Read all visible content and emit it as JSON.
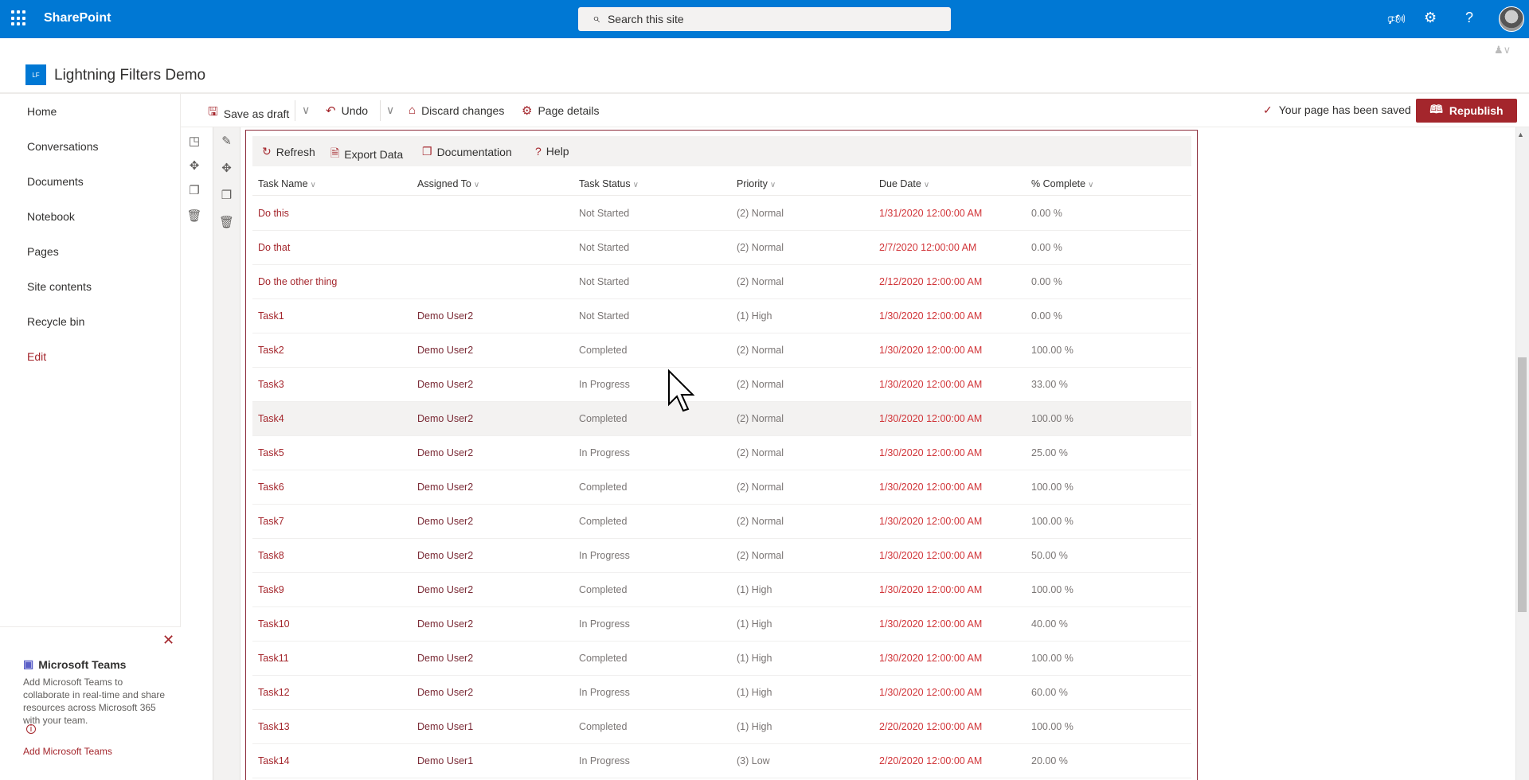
{
  "topbar": {
    "brand": "SharePoint",
    "search_placeholder": "Search this site",
    "icons": [
      "waffle-icon",
      "megaphone-icon",
      "gear-icon",
      "help-icon",
      "avatar"
    ]
  },
  "site": {
    "logo_text": "LF",
    "title": "Lightning Filters Demo"
  },
  "nav": {
    "items": [
      {
        "label": "Home"
      },
      {
        "label": "Conversations"
      },
      {
        "label": "Documents"
      },
      {
        "label": "Notebook"
      },
      {
        "label": "Pages"
      },
      {
        "label": "Site contents"
      },
      {
        "label": "Recycle bin"
      },
      {
        "label": "Edit"
      }
    ]
  },
  "commandbar": {
    "save_draft": "Save as draft",
    "undo": "Undo",
    "discard": "Discard changes",
    "page_details": "Page details",
    "saved_status": "Your page has been saved",
    "republish": "Republish"
  },
  "webpart": {
    "toolbar": {
      "refresh": "Refresh",
      "export": "Export Data",
      "documentation": "Documentation",
      "help": "Help"
    },
    "columns": [
      "Task Name",
      "Assigned To",
      "Task Status",
      "Priority",
      "Due Date",
      "% Complete"
    ],
    "rows": [
      [
        "Do this",
        "",
        "Not Started",
        "(2) Normal",
        "1/31/2020 12:00:00 AM",
        "0.00 %"
      ],
      [
        "Do that",
        "",
        "Not Started",
        "(2) Normal",
        "2/7/2020 12:00:00 AM",
        "0.00 %"
      ],
      [
        "Do the other thing",
        "",
        "Not Started",
        "(2) Normal",
        "2/12/2020 12:00:00 AM",
        "0.00 %"
      ],
      [
        "Task1",
        "Demo User2",
        "Not Started",
        "(1) High",
        "1/30/2020 12:00:00 AM",
        "0.00 %"
      ],
      [
        "Task2",
        "Demo User2",
        "Completed",
        "(2) Normal",
        "1/30/2020 12:00:00 AM",
        "100.00 %"
      ],
      [
        "Task3",
        "Demo User2",
        "In Progress",
        "(2) Normal",
        "1/30/2020 12:00:00 AM",
        "33.00 %"
      ],
      [
        "Task4",
        "Demo User2",
        "Completed",
        "(2) Normal",
        "1/30/2020 12:00:00 AM",
        "100.00 %"
      ],
      [
        "Task5",
        "Demo User2",
        "In Progress",
        "(2) Normal",
        "1/30/2020 12:00:00 AM",
        "25.00 %"
      ],
      [
        "Task6",
        "Demo User2",
        "Completed",
        "(2) Normal",
        "1/30/2020 12:00:00 AM",
        "100.00 %"
      ],
      [
        "Task7",
        "Demo User2",
        "Completed",
        "(2) Normal",
        "1/30/2020 12:00:00 AM",
        "100.00 %"
      ],
      [
        "Task8",
        "Demo User2",
        "In Progress",
        "(2) Normal",
        "1/30/2020 12:00:00 AM",
        "50.00 %"
      ],
      [
        "Task9",
        "Demo User2",
        "Completed",
        "(1) High",
        "1/30/2020 12:00:00 AM",
        "100.00 %"
      ],
      [
        "Task10",
        "Demo User2",
        "In Progress",
        "(1) High",
        "1/30/2020 12:00:00 AM",
        "40.00 %"
      ],
      [
        "Task11",
        "Demo User2",
        "Completed",
        "(1) High",
        "1/30/2020 12:00:00 AM",
        "100.00 %"
      ],
      [
        "Task12",
        "Demo User2",
        "In Progress",
        "(1) High",
        "1/30/2020 12:00:00 AM",
        "60.00 %"
      ],
      [
        "Task13",
        "Demo User1",
        "Completed",
        "(1) High",
        "2/20/2020 12:00:00 AM",
        "100.00 %"
      ],
      [
        "Task14",
        "Demo User1",
        "In Progress",
        "(3) Low",
        "2/20/2020 12:00:00 AM",
        "20.00 %"
      ]
    ],
    "hovered_row": 6
  },
  "teams": {
    "title": "Microsoft Teams",
    "description": "Add Microsoft Teams to collaborate in real-time and share resources across Microsoft 365 with your team.",
    "link": "Add Microsoft Teams"
  },
  "colors": {
    "brand": "#0078d4",
    "accent": "#a4262c",
    "date": "#d13438"
  }
}
